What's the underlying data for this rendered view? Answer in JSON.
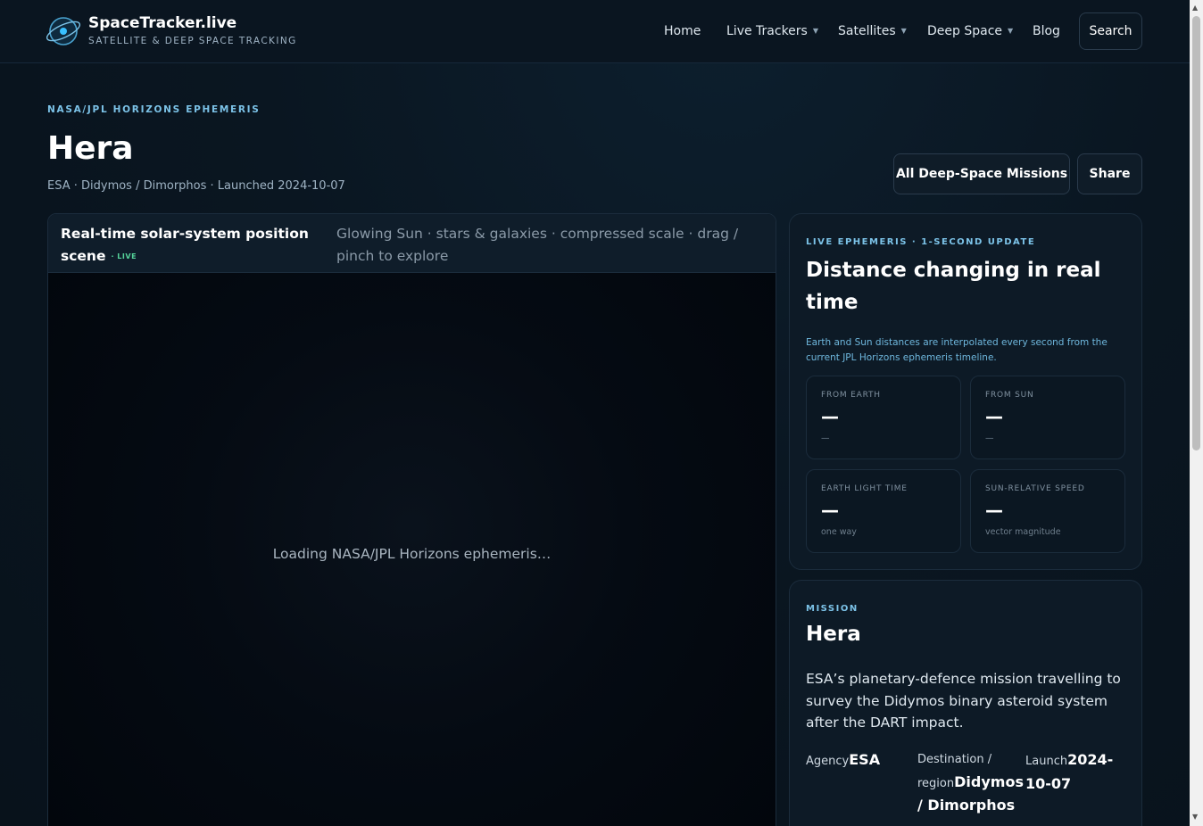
{
  "header": {
    "brand_name": "SpaceTracker.live",
    "brand_sub": "SATELLITE & DEEP SPACE TRACKING",
    "nav": [
      {
        "label": "Home",
        "dropdown": false
      },
      {
        "label": "Live Trackers",
        "dropdown": true
      },
      {
        "label": "Satellites",
        "dropdown": true
      },
      {
        "label": "Deep Space",
        "dropdown": true
      },
      {
        "label": "Blog",
        "dropdown": false
      }
    ],
    "search_label": "Search"
  },
  "hero": {
    "eyebrow": "NASA/JPL HORIZONS EPHEMERIS",
    "title": "Hera",
    "subtitle": "ESA · Didymos / Dimorphos · Launched 2024-10-07",
    "missions_button": "All Deep-Space Missions",
    "share_button": "Share"
  },
  "scene": {
    "title": "Real-time solar-system position scene",
    "live": "· LIVE",
    "hint": "Glowing Sun · stars & galaxies · compressed scale · drag / pinch to explore",
    "loading": "Loading NASA/JPL Horizons ephemeris…"
  },
  "ephemeris": {
    "eyebrow": "LIVE EPHEMERIS · 1-SECOND UPDATE",
    "title": "Distance changing in real time",
    "note": "Earth and Sun distances are interpolated every second from the current JPL Horizons ephemeris timeline.",
    "stats": [
      {
        "label": "FROM EARTH",
        "value": "—",
        "unit": "—"
      },
      {
        "label": "FROM SUN",
        "value": "—",
        "unit": "—"
      },
      {
        "label": "EARTH LIGHT TIME",
        "value": "—",
        "unit": "one way"
      },
      {
        "label": "SUN-RELATIVE SPEED",
        "value": "—",
        "unit": "vector magnitude"
      }
    ]
  },
  "mission": {
    "eyebrow": "MISSION",
    "title": "Hera",
    "description": "ESA’s planetary-defence mission travelling to survey the Didymos binary asteroid system after the DART impact.",
    "agency_label": "Agency",
    "agency_value": "ESA",
    "destination_label": "Destination / region",
    "destination_value": "Didymos / Dimorphos",
    "launch_label": "Launch",
    "launch_value": "2024-10-07"
  },
  "colors": {
    "accent": "#7cc3e8",
    "live": "#55d39a",
    "background": "#0a1621"
  }
}
